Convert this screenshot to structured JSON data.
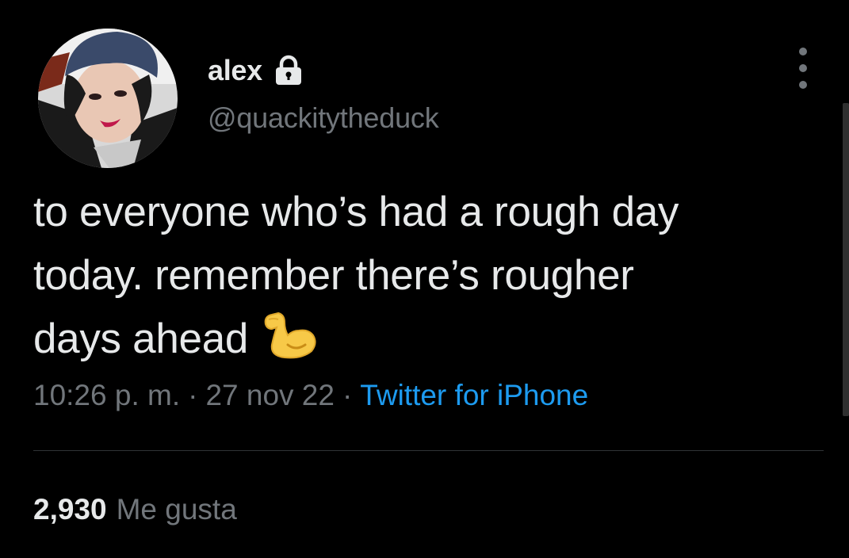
{
  "author": {
    "display_name": "alex",
    "handle": "@quackitytheduck",
    "protected_icon": "lock-icon",
    "avatar_icon": "profile-photo"
  },
  "tweet": {
    "text_line1": "to everyone who’s had a rough day",
    "text_line2": "today. remember there’s rougher",
    "text_line3": "days ahead",
    "emoji": "flexed-biceps-icon"
  },
  "meta": {
    "time": "10:26 p. m.",
    "separator": "·",
    "date": "27 nov 22",
    "source": "Twitter for iPhone"
  },
  "stats": {
    "likes_count": "2,930",
    "likes_label": "Me gusta"
  },
  "colors": {
    "background": "#000000",
    "text_primary": "#e7e9ea",
    "text_secondary": "#71767b",
    "link": "#1d9bf0",
    "emoji_yellow": "#f7c948"
  },
  "icons": {
    "more": "more-options-icon",
    "lock": "lock-icon"
  }
}
